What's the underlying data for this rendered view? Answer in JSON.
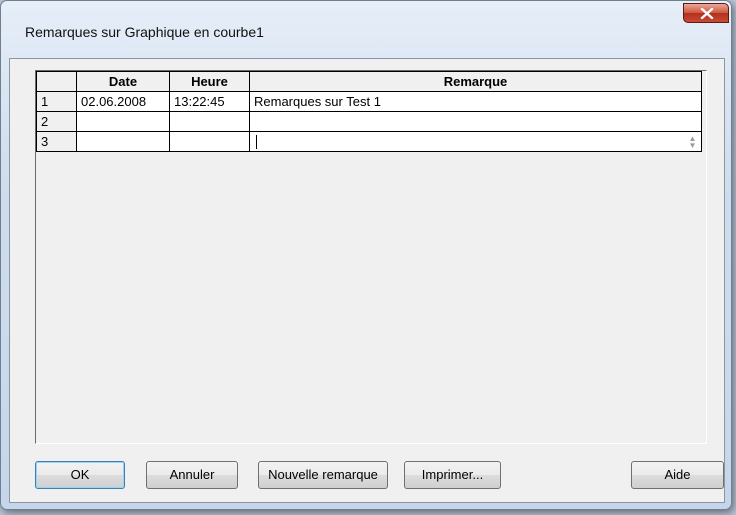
{
  "window": {
    "title": "Remarques sur Graphique en courbe1"
  },
  "table": {
    "headers": [
      "",
      "Date",
      "Heure",
      "Remarque"
    ],
    "rows": [
      {
        "num": "1",
        "date": "02.06.2008",
        "time": "13:22:45",
        "remark": "Remarques sur Test 1"
      },
      {
        "num": "2",
        "date": "",
        "time": "",
        "remark": ""
      },
      {
        "num": "3",
        "date": "",
        "time": "",
        "remark": ""
      }
    ]
  },
  "buttons": {
    "ok": "OK",
    "cancel": "Annuler",
    "new_remark": "Nouvelle remarque",
    "print": "Imprimer...",
    "help": "Aide"
  },
  "icons": {
    "close": "close-icon"
  }
}
